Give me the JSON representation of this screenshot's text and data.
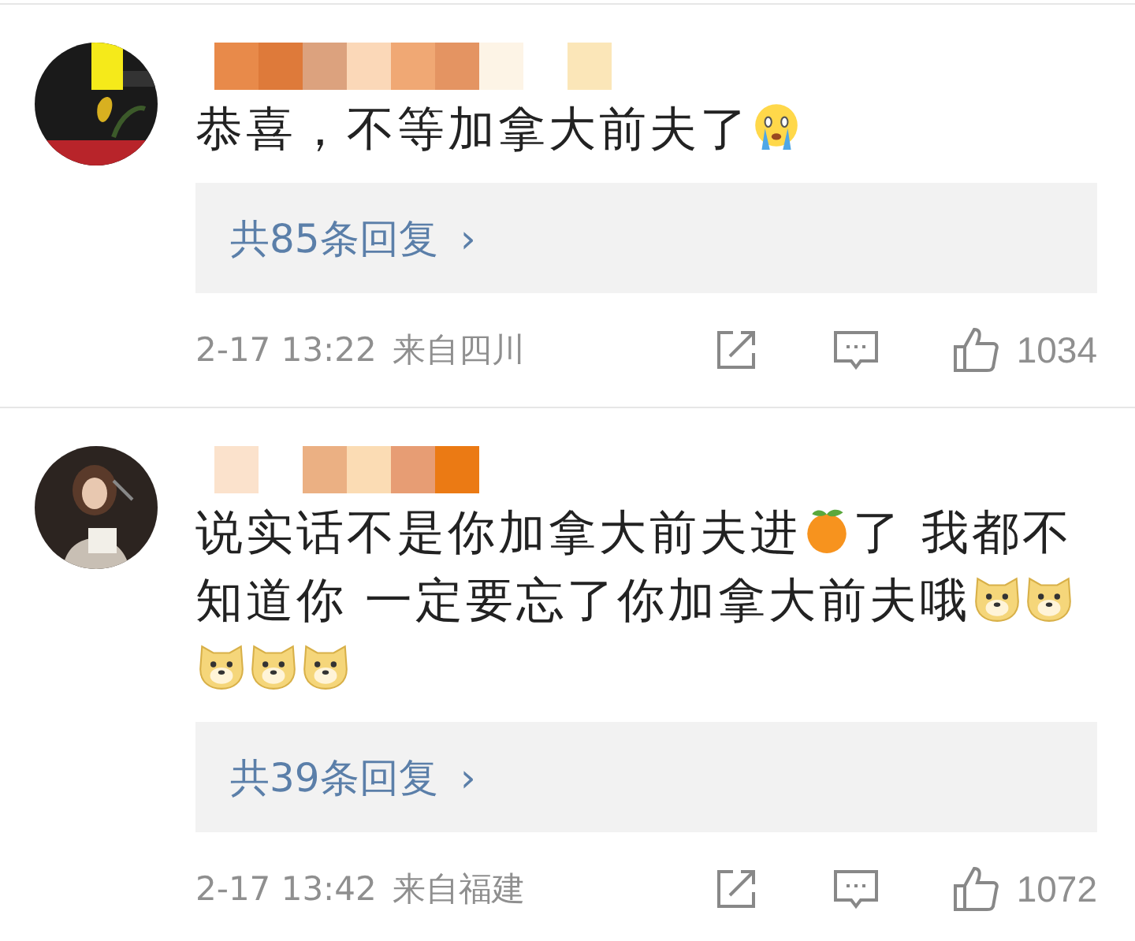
{
  "comments": [
    {
      "content": [
        {
          "kind": "text",
          "text": "恭喜，不等加拿大前夫了"
        },
        {
          "kind": "crying"
        }
      ],
      "replies": "共85条回复",
      "reply_arrow": "›",
      "time": "2-17 13:22",
      "source": "来自四川",
      "likes": "1034"
    },
    {
      "content": [
        {
          "kind": "text",
          "text": "说实话不是你加拿大前夫进"
        },
        {
          "kind": "orange"
        },
        {
          "kind": "text",
          "text": "了 我都不"
        },
        {
          "kind": "text",
          "text": "知道你 一定要忘了你加拿大前夫哦"
        },
        {
          "kind": "doge"
        },
        {
          "kind": "doge"
        },
        {
          "kind": "doge"
        },
        {
          "kind": "doge"
        },
        {
          "kind": "doge"
        }
      ],
      "replies": "共39条回复",
      "reply_arrow": "›",
      "time": "2-17 13:42",
      "source": "来自福建",
      "likes": "1072"
    }
  ]
}
